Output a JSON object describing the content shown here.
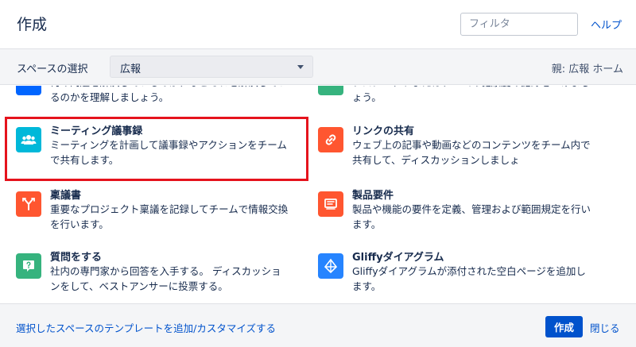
{
  "header": {
    "title": "作成",
    "filter_placeholder": "フィルタ",
    "help_label": "ヘルプ"
  },
  "space_bar": {
    "label": "スペースの選択",
    "selected_space": "広報",
    "parent_label": "親: 広報 ホーム"
  },
  "templates": [
    {
      "title": "",
      "desc": "何の問題を解決しているのか、なぜそれを解決しているのかを理解しましょう。",
      "icon": "template-icon",
      "color": "#0065ff"
    },
    {
      "title": "",
      "desc": "プロジェクトまたはチームの健康度の記録をつけましょう。",
      "icon": "health-icon",
      "color": "#36b37e"
    },
    {
      "title": "ミーティング議事録",
      "desc": "ミーティングを計画して議事録やアクションをチームで共有します。",
      "icon": "people-icon",
      "color": "#00b8d9"
    },
    {
      "title": "リンクの共有",
      "desc": "ウェブ上の記事や動画などのコンテンツをチーム内で共有して、ディスカッションしましょ",
      "icon": "link-icon",
      "color": "#ff5630"
    },
    {
      "title": "稟議書",
      "desc": "重要なプロジェクト稟議を記録してチームで情報交換を行います。",
      "icon": "decision-icon",
      "color": "#ff5630"
    },
    {
      "title": "製品要件",
      "desc": "製品や機能の要件を定義、管理および範囲規定を行います。",
      "icon": "requirements-icon",
      "color": "#ff5630"
    },
    {
      "title": "質問をする",
      "desc": "社内の専門家から回答を入手する。 ディスカッションをして、ベストアンサーに投票する。",
      "icon": "question-icon",
      "color": "#36b37e"
    },
    {
      "title": "Gliffyダイアグラム",
      "desc": "Gliffyダイアグラムが添付された空白ページを追加します。",
      "icon": "gliffy-icon",
      "color": "#2684ff"
    }
  ],
  "footer": {
    "customize_link": "選択したスペースのテンプレートを追加/カスタマイズする",
    "create_label": "作成",
    "close_label": "閉じる"
  }
}
